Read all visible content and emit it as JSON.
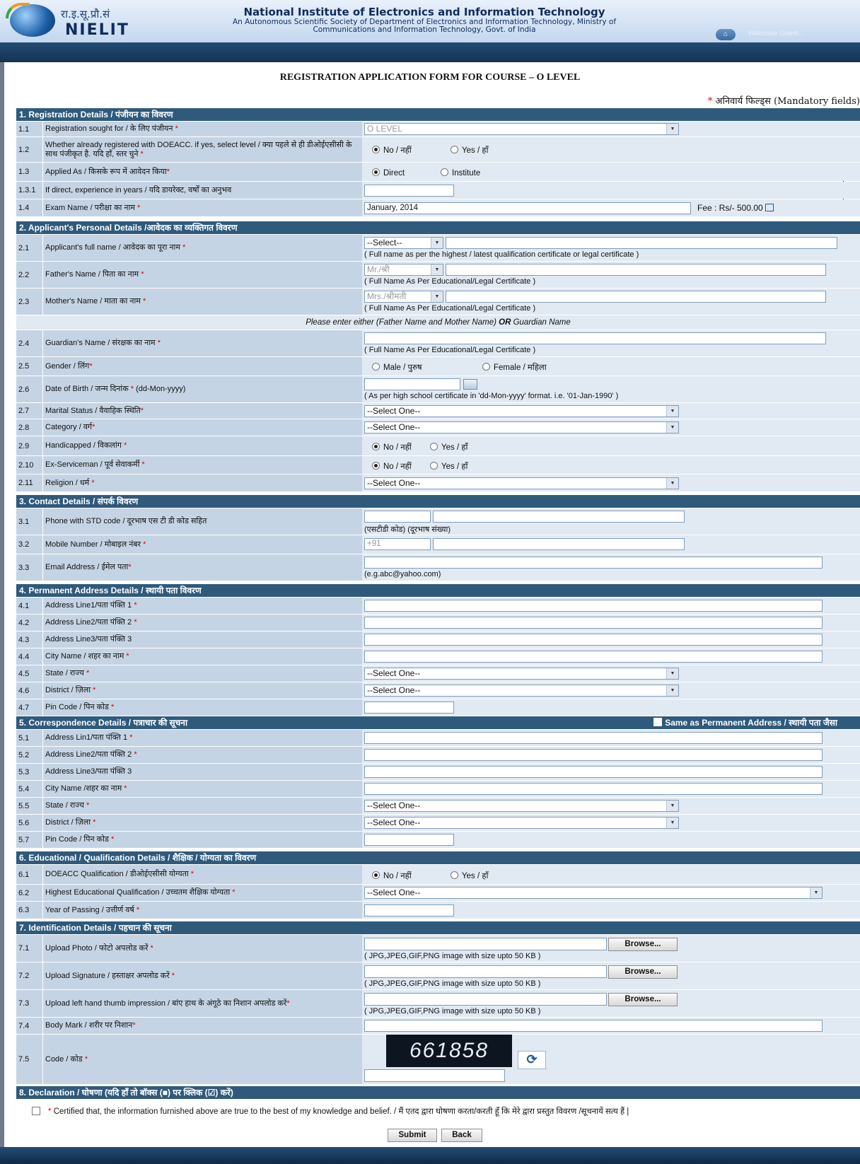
{
  "header": {
    "logo_hindi": "रा.इ.सू.प्रौ.सं",
    "logo_english": "NIELIT",
    "org_name": "National Institute of Electronics and Information Technology",
    "org_sub_1": "An Autonomous Scientific Society of Department of Electronics and Information Technology, Ministry of",
    "org_sub_2": "Communications and Information Technology, Govt. of India",
    "welcome": "Welcome Guest..."
  },
  "form_title": "REGISTRATION APPLICATION FORM FOR COURSE – O LEVEL",
  "mandatory_note": "अनिवार्य फिल्ड्स (Mandatory fields)",
  "sections": {
    "s1": "1. Registration Details / पंजीयन का विवरण",
    "s2": "2. Applicant's Personal Details /आवेदक का व्यक्तिगत विवरण",
    "s3": "3. Contact Details / संपर्क विवरण",
    "s4": "4. Permanent Address Details / स्थायी पता विवरण",
    "s5": "5. Correspondence Details / पत्राचार की सूचना",
    "s6": "6. Educational / Qualification Details / शैक्षिक / योग्यता का विवरण",
    "s7": "7. Identification Details / पहचान की सूचना",
    "s8": "8. Declaration / घोषणा (यदि हाँ तो बॉक्स (■) पर क्लिक (☑) करें)"
  },
  "fields": {
    "f1_1": {
      "no": "1.1",
      "label": "Registration sought for / के लिए पंजीयन",
      "value": "O LEVEL"
    },
    "f1_2": {
      "no": "1.2",
      "label": "Whether already registered with DOEACC. if yes, select level / क्या पहले से ही डीओईएसीसी के साथ पंजीकृत है. यदि हाँ, स्तर चुने",
      "opt1": "No / नहीं",
      "opt2": "Yes / हाँ"
    },
    "f1_3": {
      "no": "1.3",
      "label": "Applied As / किसके रूप में आवेदन किया",
      "opt1": "Direct",
      "opt2": "Institute"
    },
    "f1_3_1": {
      "no": "1.3.1",
      "label": "If direct, experience in years / यदि डायरेक्ट, वर्षों का अनुभव"
    },
    "f1_4": {
      "no": "1.4",
      "label": "Exam Name / परीक्षा का नाम",
      "value": "January, 2014",
      "fee": "Fee : Rs/- 500.00"
    },
    "f2_1": {
      "no": "2.1",
      "label": "Applicant's full name / आवेदक का पूरा नाम",
      "select": "--Select--",
      "hint": "( Full name as per the highest / latest qualification certificate or legal certificate )"
    },
    "f2_2": {
      "no": "2.2",
      "label": "Father's Name / पिता का नाम",
      "select": "Mr./श्री",
      "hint": "( Full Name As Per Educational/Legal Certificate )"
    },
    "f2_3": {
      "no": "2.3",
      "label": "Mother's Name / माता का नाम",
      "select": "Mrs./श्रीमती",
      "hint": "( Full Name As Per Educational/Legal Certificate )"
    },
    "note_either_1": "Please enter either (Father Name and Mother Name)",
    "note_either_or": "OR",
    "note_either_2": "Guardian Name",
    "f2_4": {
      "no": "2.4",
      "label": "Guardian's Name / संरक्षक का नाम",
      "hint": "( Full Name As Per Educational/Legal Certificate )"
    },
    "f2_5": {
      "no": "2.5",
      "label": "Gender / लिंग",
      "opt1": "Male / पुरुष",
      "opt2": "Female / महिला"
    },
    "f2_6": {
      "no": "2.6",
      "label": "Date of Birth / जन्म दिनांक",
      "label_fmt": "(dd-Mon-yyyy)",
      "hint": "( As per high school certificate in 'dd-Mon-yyyy' format. i.e. '01-Jan-1990' )"
    },
    "f2_7": {
      "no": "2.7",
      "label": "Marital Status / वैवाहिक स्थिति",
      "select": "--Select One--"
    },
    "f2_8": {
      "no": "2.8",
      "label": "Category / वर्ग",
      "select": "--Select One--"
    },
    "f2_9": {
      "no": "2.9",
      "label": "Handicapped / विकलांग",
      "opt1": "No / नहीं",
      "opt2": "Yes / हाँ"
    },
    "f2_10": {
      "no": "2.10",
      "label": "Ex-Serviceman / पूर्व सेवाकर्मी",
      "opt1": "No / नहीं",
      "opt2": "Yes / हाँ"
    },
    "f2_11": {
      "no": "2.11",
      "label": "Religion / धर्म",
      "select": "--Select One--"
    },
    "f3_1": {
      "no": "3.1",
      "label": "Phone with STD code / दूरभाष एस टी डी कोड सहित",
      "hint": "(एसटीडी कोड) (दूरभाष संख्या)"
    },
    "f3_2": {
      "no": "3.2",
      "label": "Mobile Number / मोबाइल नंबर",
      "prefix": "+91"
    },
    "f3_3": {
      "no": "3.3",
      "label": "Email Address / ईमेल पता",
      "hint": "(e.g.abc@yahoo.com)"
    },
    "f4_1": {
      "no": "4.1",
      "label": "Address Line1/पता पंक्ति 1"
    },
    "f4_2": {
      "no": "4.2",
      "label": "Address Line2/पता पंक्ति 2"
    },
    "f4_3": {
      "no": "4.3",
      "label": "Address Line3/पता पंक्ति 3"
    },
    "f4_4": {
      "no": "4.4",
      "label": "City Name / शहर का नाम"
    },
    "f4_5": {
      "no": "4.5",
      "label": "State / राज्य",
      "select": "--Select One--"
    },
    "f4_6": {
      "no": "4.6",
      "label": "District / ज़िला",
      "select": "--Select One--"
    },
    "f4_7": {
      "no": "4.7",
      "label": "Pin Code / पिन कोड"
    },
    "same_as": "Same as Permanent Address / स्थायी पता जैसा",
    "f5_1": {
      "no": "5.1",
      "label": "Address Lin1/पता पंक्ति 1"
    },
    "f5_2": {
      "no": "5.2",
      "label": "Address Line2/पता पंक्ति 2"
    },
    "f5_3": {
      "no": "5.3",
      "label": "Address Line3/पता पंक्ति 3"
    },
    "f5_4": {
      "no": "5.4",
      "label": "City Name /शहर का नाम"
    },
    "f5_5": {
      "no": "5.5",
      "label": "State / राज्य",
      "select": "--Select One--"
    },
    "f5_6": {
      "no": "5.6",
      "label": "District / ज़िला",
      "select": "--Select One--"
    },
    "f5_7": {
      "no": "5.7",
      "label": "Pin Code / पिन कोड"
    },
    "f6_1": {
      "no": "6.1",
      "label": "DOEACC Qualification / डीओईएसीसी योग्यता",
      "opt1": "No / नहीं",
      "opt2": "Yes / हाँ"
    },
    "f6_2": {
      "no": "6.2",
      "label": "Highest Educational Qualification / उच्चतम शैक्षिक योग्यता",
      "select": "--Select One--"
    },
    "f6_3": {
      "no": "6.3",
      "label": "Year of Passing / उत्तीर्ण वर्ष"
    },
    "f7_1": {
      "no": "7.1",
      "label": "Upload Photo / फोटो अपलोड करें",
      "hint": "( JPG,JPEG,GIF,PNG image with size upto 50 KB )"
    },
    "f7_2": {
      "no": "7.2",
      "label": "Upload Signature / हस्ताक्षर अपलोड करें",
      "hint": "( JPG,JPEG,GIF,PNG image with size upto 50 KB )"
    },
    "f7_3": {
      "no": "7.3",
      "label": "Upload left hand thumb impression / बांए हाथ के अंगूठे का निशान अपलोड करें",
      "hint": "( JPG,JPEG,GIF,PNG image with size upto 50 KB )"
    },
    "f7_4": {
      "no": "7.4",
      "label": "Body Mark / शरीर पर निशान"
    },
    "f7_5": {
      "no": "7.5",
      "label": "Code / कोड",
      "captcha": "661858"
    },
    "browse": "Browse..."
  },
  "declaration": "Certified that, the information furnished above are true to the best of my knowledge and belief. / मैं एतद द्वारा घोषणा करता/करती हूँ कि मेरे द्वारा प्रस्तुत विवरण /सूचनायें सत्य हैं |",
  "buttons": {
    "submit": "Submit",
    "back": "Back"
  },
  "star": "*",
  "icons": {
    "home": "home-icon",
    "calendar": "calendar-icon",
    "refresh": "refresh-icon",
    "fee": "external-link-icon"
  }
}
